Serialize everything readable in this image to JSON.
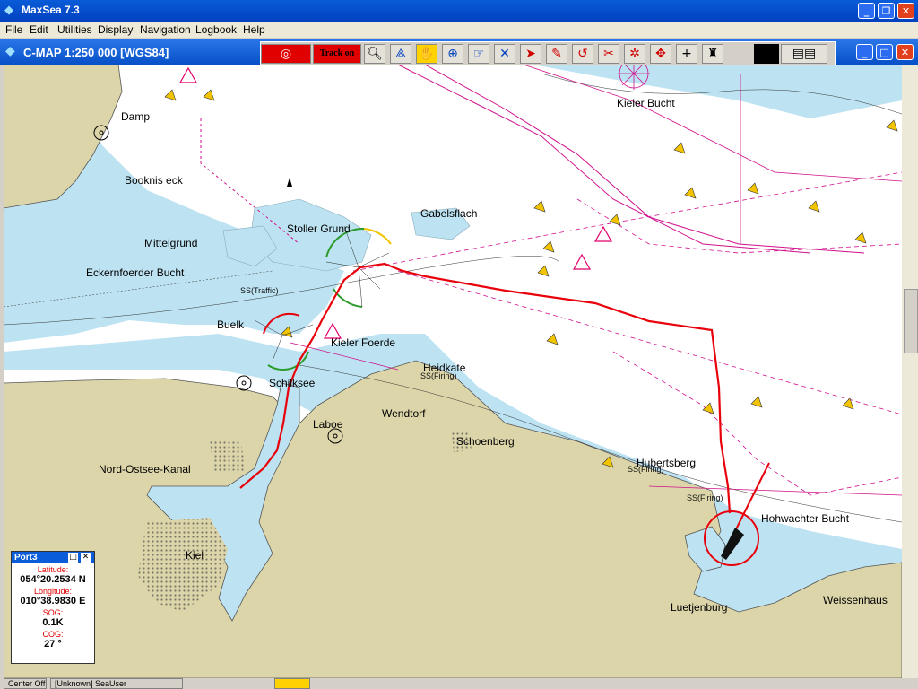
{
  "app": {
    "title": "MaxSea 7.3"
  },
  "menu": [
    "File",
    "Edit",
    "Utilities",
    "Display",
    "Navigation",
    "Logbook",
    "Help"
  ],
  "chart_window": {
    "title": "C-MAP  1:250 000 [WGS84]"
  },
  "toolbar": {
    "track_label": "Track on"
  },
  "places": {
    "damp": "Damp",
    "boknis": "Booknis eck",
    "mittelgrund": "Mittelgrund",
    "eckern": "Eckernfoerder Bucht",
    "stoller": "Stoller Grund",
    "gabels": "Gabelsflach",
    "kieler_bucht": "Kieler Bucht",
    "buelk": "Buelk",
    "kieler_foerde": "Kieler Foerde",
    "heidkate": "Heidkate",
    "schilksee": "Schilksee",
    "laboe": "Laboe",
    "wendtorf": "Wendtorf",
    "schoenberg": "Schoenberg",
    "nok": "Nord-Ostsee-Kanal",
    "kiel": "Kiel",
    "hubertsberg": "Hubertsberg",
    "hohwacht": "Hohwachter Bucht",
    "luetjenburg": "Luetjenburg",
    "weissenhaus": "Weissenhaus",
    "ss_traffic": "SS(Traffic)",
    "ss_firing_1": "SS(Firing)",
    "ss_firing_2": "SS(Firing)",
    "ss_firing_3": "SS(Firing)"
  },
  "port_panel": {
    "title": "Port3",
    "latitude_label": "Latitude:",
    "latitude": "054°20.2534 N",
    "longitude_label": "Longitude:",
    "longitude": "010°38.9830 E",
    "sog_label": "SOG:",
    "sog": "0.1K",
    "cog_label": "COG:",
    "cog": "27 °"
  },
  "status": {
    "left": "Center Off",
    "user": "[Unknown] SeaUser"
  },
  "colors": {
    "land": "#dcd5a9",
    "shallow": "#bde3f2",
    "deep": "#ffffff",
    "route": "#e8000b",
    "eez": "#d0108c"
  },
  "icons": [
    "target-icon",
    "zoom-icon",
    "compass-icon",
    "hand-icon",
    "crosshair-icon",
    "pan-icon",
    "cursor-icon",
    "pencil-icon",
    "arrow-icon",
    "scissors-icon",
    "edit-icon",
    "move-icon",
    "plus-icon",
    "buoy-icon"
  ]
}
